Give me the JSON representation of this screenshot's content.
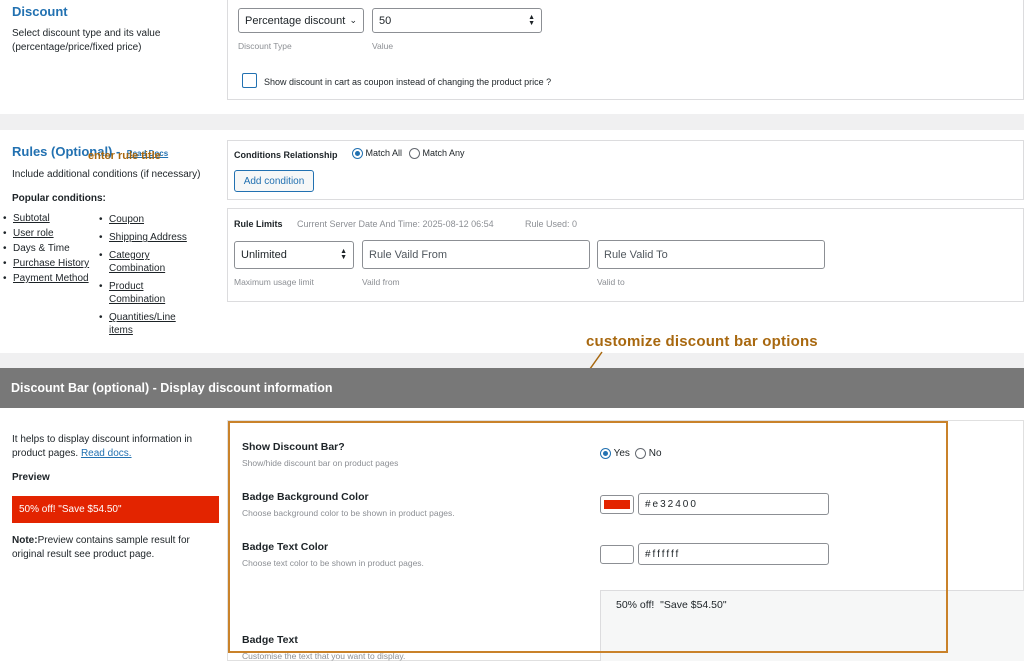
{
  "discount": {
    "title": "Discount",
    "description": "Select discount type and its value (percentage/price/fixed price)",
    "type_value": "Percentage discount",
    "type_label": "Discount Type",
    "value": "50",
    "value_label": "Value",
    "coupon_checkbox_label": "Show discount in cart as coupon instead of changing the product price ?"
  },
  "rules": {
    "title": "Rules (Optional) -",
    "read_docs": "Read Docs",
    "overlay_annotation": "enter rule title",
    "description": "Include additional conditions (if necessary)",
    "popular_title": "Popular conditions:",
    "popular_left": [
      "Subtotal",
      "User role",
      "Days & Time",
      "Purchase History",
      "Payment Method"
    ],
    "popular_right": [
      "Coupon",
      "Shipping Address",
      "Category Combination",
      "Product Combination",
      "Quantities/Line items"
    ],
    "conditions_relationship_label": "Conditions Relationship",
    "match_all": "Match All",
    "match_any": "Match Any",
    "add_condition": "Add condition",
    "limits_title": "Rule Limits",
    "server_time": "Current Server Date And Time: 2025-08-12 06:54",
    "rule_used": "Rule Used: 0",
    "max_usage_value": "Unlimited",
    "max_usage_label": "Maximum usage limit",
    "valid_from_placeholder": "Rule Vaild From",
    "valid_from_label": "Vaild from",
    "valid_to_placeholder": "Rule Valid To",
    "valid_to_label": "Valid to"
  },
  "annotation": {
    "text": "customize discount bar options",
    "color": "#a8680f"
  },
  "discount_bar": {
    "header": "Discount Bar (optional) - Display discount information",
    "help_text": "It helps to display discount information in product pages.",
    "read_docs": "Read docs.",
    "preview_label": "Preview",
    "preview_text": "50% off! \"Save $54.50\"",
    "note_bold": "Note:",
    "note_text": "Preview contains sample result for original result see product page.",
    "show_title": "Show Discount Bar?",
    "show_desc": "Show/hide discount bar on product pages",
    "yes": "Yes",
    "no": "No",
    "bg_title": "Badge Background Color",
    "bg_desc": "Choose background color to be shown in product pages.",
    "bg_value": "#e32400",
    "text_color_title": "Badge Text Color",
    "text_color_desc": "Choose text color to be shown in product pages.",
    "text_color_value": "#ffffff",
    "badge_text_title": "Badge Text",
    "badge_text_desc": "Customise the text that you want to display.",
    "badge_text_value": "50% off!  \"Save $54.50\""
  }
}
